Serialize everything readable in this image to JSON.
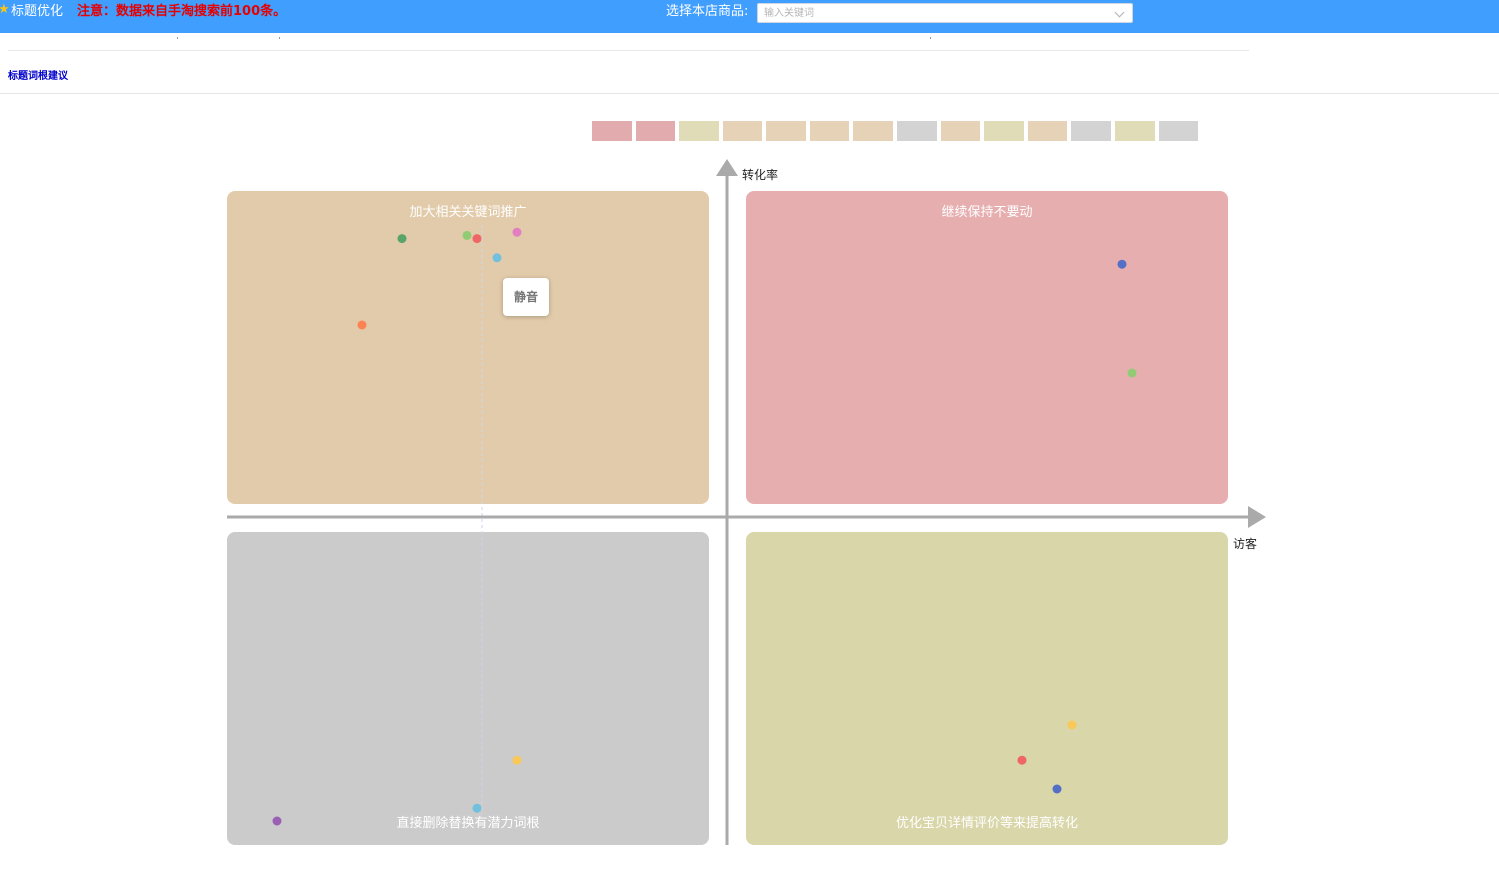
{
  "header": {
    "title": "标题优化",
    "notice": "注意：数据来自手淘搜索前100条。",
    "select_label": "选择本店商品:",
    "select_placeholder": "输入关键词"
  },
  "section": {
    "link": "标题词根建议"
  },
  "colors": {
    "topbar": "#409eff",
    "tan": "#e2cbaa",
    "pink": "#e7aeb0",
    "gray": "#cbcbcb",
    "olive": "#d9d6aa"
  },
  "legend_colors": [
    "#dd9ea1",
    "#dd9ea1",
    "#d9d6aa",
    "#e2cbaa",
    "#e2cbaa",
    "#e2cbaa",
    "#e2cbaa",
    "#cbcbcb",
    "#e2cbaa",
    "#d9d6aa",
    "#e2cbaa",
    "#cbcbcb",
    "#d9d6aa",
    "#cbcbcb"
  ],
  "quadrants": {
    "top_left": "加大相关关键词推广",
    "top_right": "继续保持不要动",
    "bottom_left": "直接删除替换有潜力词根",
    "bottom_right": "优化宝贝详情评价等来提高转化"
  },
  "chart_data": {
    "type": "scatter",
    "xlabel": "访客",
    "ylabel": "转化率",
    "points": [
      {
        "x": -0.65,
        "y": 0.87,
        "color": "#5aa469"
      },
      {
        "x": -0.52,
        "y": 0.88,
        "color": "#91cc75"
      },
      {
        "x": -0.5,
        "y": 0.87,
        "color": "#ee6666"
      },
      {
        "x": -0.42,
        "y": 0.89,
        "color": "#e27ec1"
      },
      {
        "x": -0.46,
        "y": 0.81,
        "color": "#73c0de"
      },
      {
        "x": -0.73,
        "y": 0.6,
        "color": "#fc8452"
      },
      {
        "x": 0.79,
        "y": 0.79,
        "color": "#5470c6"
      },
      {
        "x": 0.81,
        "y": 0.45,
        "color": "#91cc75"
      },
      {
        "x": -0.42,
        "y": -0.76,
        "color": "#fac858"
      },
      {
        "x": -0.5,
        "y": -0.91,
        "color": "#73c0de"
      },
      {
        "x": -0.9,
        "y": -0.95,
        "color": "#9a60b4"
      },
      {
        "x": 0.69,
        "y": -0.65,
        "color": "#fac858"
      },
      {
        "x": 0.59,
        "y": -0.76,
        "color": "#ee6666"
      },
      {
        "x": 0.66,
        "y": -0.85,
        "color": "#5470c6"
      }
    ],
    "tooltip": "静音"
  }
}
